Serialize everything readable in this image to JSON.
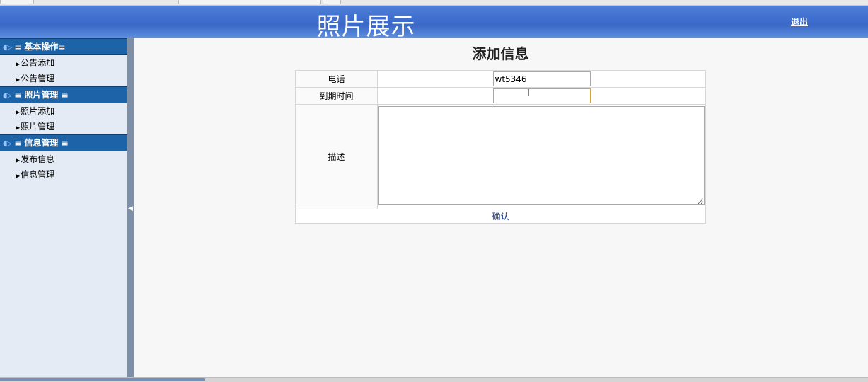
{
  "header": {
    "title": "照片展示",
    "logout_label": "退出"
  },
  "sidebar": {
    "groups": [
      {
        "label": "≡ 基本操作≡",
        "items": [
          "公告添加",
          "公告管理"
        ]
      },
      {
        "label": "≡ 照片管理 ≡",
        "items": [
          "照片添加",
          "照片管理"
        ]
      },
      {
        "label": "≡ 信息管理 ≡",
        "items": [
          "发布信息",
          "信息管理"
        ]
      }
    ]
  },
  "form": {
    "title": "添加信息",
    "phone_label": "电话",
    "phone_value": "wt5346",
    "expire_label": "到期时间",
    "expire_value": "",
    "desc_label": "描述",
    "desc_value": "",
    "submit_label": "确认"
  },
  "icons": {
    "group": "speaker-icon",
    "item": "triangle-right-icon",
    "splitter": "triangle-left-icon"
  },
  "colors": {
    "header": "#3f6fcf",
    "group_head": "#1d63a8",
    "splitter": "#7e8fa6"
  }
}
